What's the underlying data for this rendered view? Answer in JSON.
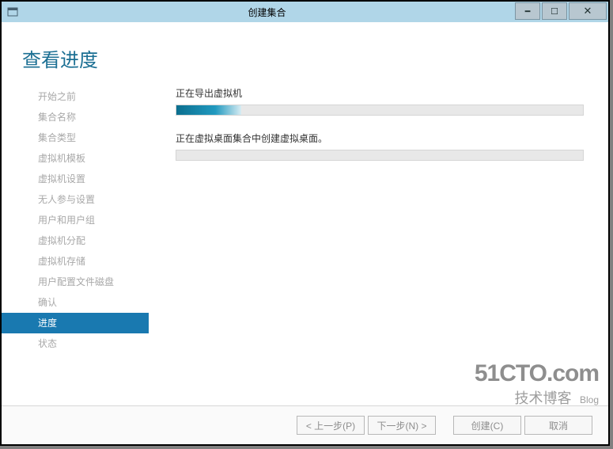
{
  "window": {
    "title": "创建集合"
  },
  "page_title": "查看进度",
  "sidebar": {
    "items": [
      {
        "label": "开始之前"
      },
      {
        "label": "集合名称"
      },
      {
        "label": "集合类型"
      },
      {
        "label": "虚拟机模板"
      },
      {
        "label": "虚拟机设置"
      },
      {
        "label": "无人参与设置"
      },
      {
        "label": "用户和用户组"
      },
      {
        "label": "虚拟机分配"
      },
      {
        "label": "虚拟机存储"
      },
      {
        "label": "用户配置文件磁盘"
      },
      {
        "label": "确认"
      },
      {
        "label": "进度",
        "active": true
      },
      {
        "label": "状态"
      }
    ]
  },
  "tasks": [
    {
      "label": "正在导出虚拟机",
      "percent": 16
    },
    {
      "label": "正在虚拟桌面集合中创建虚拟桌面。",
      "percent": 0
    }
  ],
  "buttons": {
    "prev": "< 上一步(P)",
    "next": "下一步(N) >",
    "create": "创建(C)",
    "cancel": "取消"
  },
  "watermark": {
    "line1": "51CTO.com",
    "line2": "技术博客",
    "blog": "Blog"
  }
}
